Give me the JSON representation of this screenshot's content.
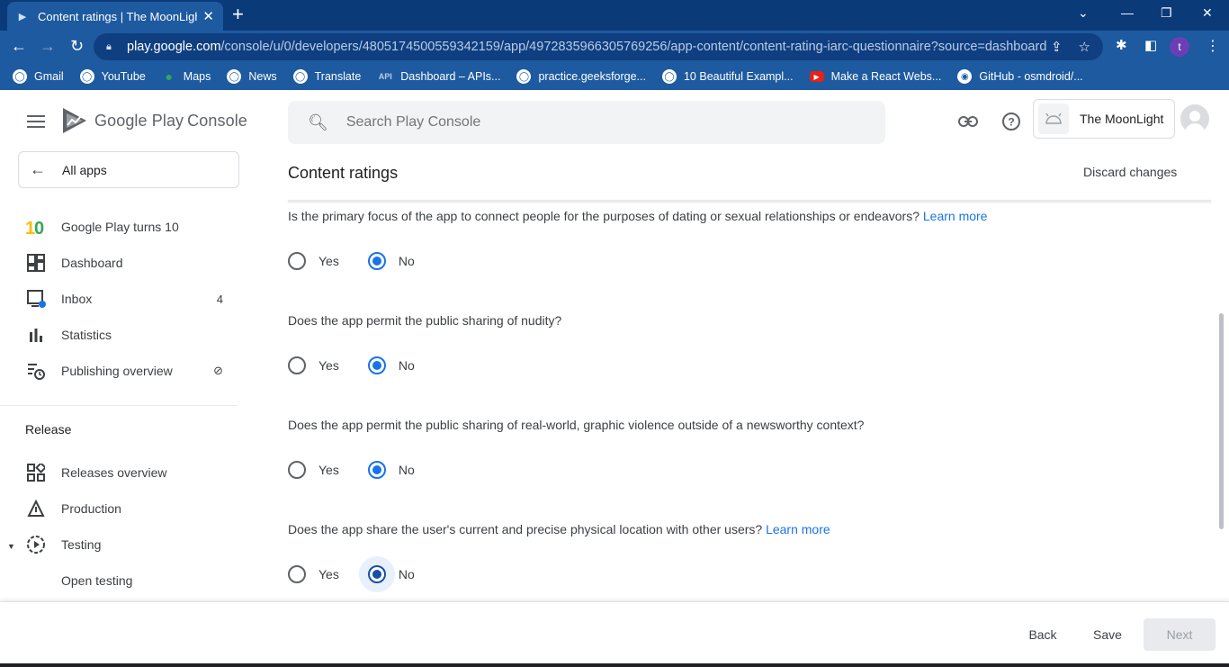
{
  "browser": {
    "tab_title": "Content ratings | The MoonLight",
    "url_host": "play.google.com",
    "url_path": "/console/u/0/developers/4805174500559342159/app/4972835966305769256/app-content/content-rating-iarc-questionnaire?source=dashboard",
    "profile_initial": "t",
    "bookmarks": [
      {
        "label": "Gmail",
        "icon": "gmail-icon"
      },
      {
        "label": "YouTube",
        "icon": "globe-icon"
      },
      {
        "label": "Maps",
        "icon": "maps-pin-icon"
      },
      {
        "label": "News",
        "icon": "globe-icon"
      },
      {
        "label": "Translate",
        "icon": "globe-icon"
      },
      {
        "label": "Dashboard – APIs...",
        "icon": "api-icon"
      },
      {
        "label": "practice.geeksforge...",
        "icon": "globe-icon"
      },
      {
        "label": "10 Beautiful Exampl...",
        "icon": "globe-icon"
      },
      {
        "label": "Make a React Webs...",
        "icon": "youtube-icon"
      },
      {
        "label": "GitHub - osmdroid/...",
        "icon": "github-icon"
      }
    ]
  },
  "header": {
    "brand_google_play": "Google Play",
    "brand_console": "Console",
    "search_placeholder": "Search Play Console",
    "account_name": "The MoonLight"
  },
  "sidebar": {
    "all_apps": "All apps",
    "items": [
      {
        "label": "Google Play turns 10",
        "icon": "play-10-icon",
        "badge": ""
      },
      {
        "label": "Dashboard",
        "icon": "dashboard-icon",
        "badge": ""
      },
      {
        "label": "Inbox",
        "icon": "inbox-icon",
        "badge": "4"
      },
      {
        "label": "Statistics",
        "icon": "bar-chart-icon",
        "badge": ""
      },
      {
        "label": "Publishing overview",
        "icon": "publishing-icon",
        "badge": ""
      }
    ],
    "release_section": "Release",
    "release_items": [
      {
        "label": "Releases overview",
        "icon": "releases-icon"
      },
      {
        "label": "Production",
        "icon": "production-icon"
      },
      {
        "label": "Testing",
        "icon": "testing-icon"
      },
      {
        "label": "Open testing",
        "icon": ""
      }
    ]
  },
  "main": {
    "title": "Content ratings",
    "discard": "Discard changes",
    "learn_more": "Learn more",
    "yes": "Yes",
    "no": "No",
    "questions": [
      {
        "text": "Is the primary focus of the app to connect people for the purposes of dating or sexual relationships or endeavors?",
        "has_link": true,
        "selected": "No"
      },
      {
        "text": "Does the app permit the public sharing of nudity?",
        "has_link": false,
        "selected": "No"
      },
      {
        "text": "Does the app permit the public sharing of real-world, graphic violence outside of a newsworthy context?",
        "has_link": false,
        "selected": "No"
      },
      {
        "text": "Does the app share the user's current and precise physical location with other users?",
        "has_link": true,
        "selected": "No"
      }
    ]
  },
  "footer": {
    "back": "Back",
    "save": "Save",
    "next": "Next"
  },
  "colors": {
    "chrome_dark": "#0a3a78",
    "chrome": "#1d5aa0",
    "accent": "#1a73e8",
    "text": "#3c4043"
  }
}
